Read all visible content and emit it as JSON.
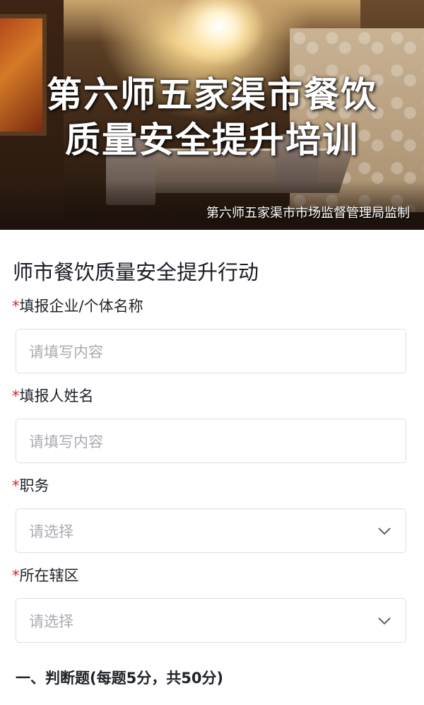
{
  "banner": {
    "title_line1": "第六师五家渠市餐饮",
    "title_line2": "质量安全提升培训",
    "credit": "第六师五家渠市市场监督管理局监制"
  },
  "form": {
    "title": "师市餐饮质量安全提升行动",
    "required_mark": "*",
    "fields": [
      {
        "label": "填报企业/个体名称",
        "type": "text",
        "placeholder": "请填写内容",
        "required": true
      },
      {
        "label": "填报人姓名",
        "type": "text",
        "placeholder": "请填写内容",
        "required": true
      },
      {
        "label": "职务",
        "type": "select",
        "placeholder": "请选择",
        "required": true
      },
      {
        "label": "所在辖区",
        "type": "select",
        "placeholder": "请选择",
        "required": true
      }
    ],
    "section": "一、判断题(每题5分，共50分)"
  },
  "colors": {
    "required": "#e02020",
    "border": "#dcdfe6",
    "placeholder": "#a8abb2"
  },
  "icons": {
    "select_arrow": "chevron-down-icon"
  }
}
